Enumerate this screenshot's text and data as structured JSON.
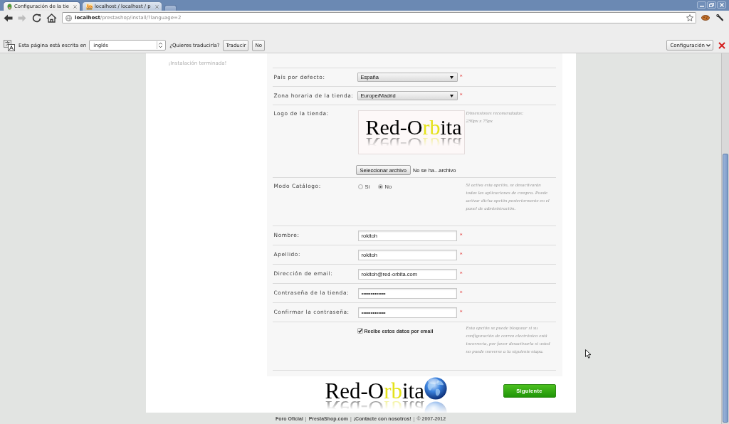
{
  "browser": {
    "tabs": [
      {
        "title": "Configuración de la tie",
        "selected": true
      },
      {
        "title": "localhost / localhost / p",
        "selected": false
      }
    ],
    "nav_buttons": [
      {
        "kind": "back",
        "disabled": false
      },
      {
        "kind": "forward",
        "disabled": true
      },
      {
        "kind": "reload",
        "disabled": false
      },
      {
        "kind": "home",
        "disabled": false
      }
    ],
    "address": "**localhost**/prestashop/install/?language=2"
  },
  "translate_bar": {
    "message": "Esta página está escrita en",
    "language": "inglés",
    "question": "¿Quieres traducirla?",
    "buttons": [
      "Traducir",
      "No"
    ],
    "options_button": "Configuración"
  },
  "sidebar": {
    "items": [
      "¡Instalación terminada!"
    ]
  },
  "form": {
    "rows": [
      {
        "kind": "select",
        "label": "País por defecto:",
        "value": "España",
        "required_mark": "*"
      },
      {
        "kind": "select",
        "label": "Zona horaria de la tienda:",
        "value": "Europe/Madrid",
        "required_mark": "*"
      },
      {
        "kind": "logo",
        "label": "Logo de la tienda:",
        "logo": [
          {
            "text": "Red-O",
            "highlight": false
          },
          {
            "text": "rb",
            "highlight": true
          },
          {
            "text": "ita",
            "highlight": false
          }
        ],
        "file_button": "Seleccionar archivo",
        "file_status": "No se ha...archivo",
        "hint": [
          "Dimensiones recomendadas:",
          "230px x 75px"
        ]
      },
      {
        "kind": "radio",
        "label": "Modo Catálogo:",
        "options": [
          {
            "label": "Sí",
            "selected": false
          },
          {
            "label": "No",
            "selected": true
          }
        ],
        "hint": [
          "Si activa esta opción, se desactivarán",
          "todas las aplicaciones de compra. Puede",
          "activar dicha opción posteriormente en el",
          "panel de administración."
        ]
      },
      {
        "kind": "text",
        "label": "Nombre:",
        "value": "rokitoh",
        "required_mark": "*"
      },
      {
        "kind": "text",
        "label": "Apellido:",
        "value": "rokitoh",
        "required_mark": "*"
      },
      {
        "kind": "text",
        "label": "Dirección de email:",
        "value": "rokitoh@red-orbita.com",
        "required_mark": "*"
      },
      {
        "kind": "text",
        "label": "Contraseña de la tienda:",
        "value": "•••••••••••••",
        "required_mark": "*"
      },
      {
        "kind": "text",
        "label": "Confirmar la contraseña:",
        "value": "•••••••••••••",
        "required_mark": "*"
      },
      {
        "kind": "checkbox",
        "label": "Recibe estos datos por email",
        "checked": true,
        "hint": [
          "Esta opción se puede bloquear si su",
          "configuración de correo electrónico está",
          "incorrecta, por favor desactivarla si usted",
          "no puede moverse a la siguiente etapa."
        ]
      }
    ]
  },
  "next_button": "Siguiente",
  "footer_logo": [
    {
      "text": "Red-O",
      "highlight": false
    },
    {
      "text": "rb",
      "highlight": true
    },
    {
      "text": "ita",
      "highlight": false
    }
  ],
  "footer": {
    "items": [
      {
        "kind": "link",
        "text": "Foro Oficial"
      },
      {
        "kind": "separator",
        "text": "|"
      },
      {
        "kind": "link",
        "text": "PrestaShop.com"
      },
      {
        "kind": "separator",
        "text": "|"
      },
      {
        "kind": "link",
        "text": "¡Contacte con nosotros!"
      },
      {
        "kind": "separator",
        "text": "|"
      },
      {
        "kind": "text",
        "text": "© 2007-2012"
      }
    ]
  }
}
